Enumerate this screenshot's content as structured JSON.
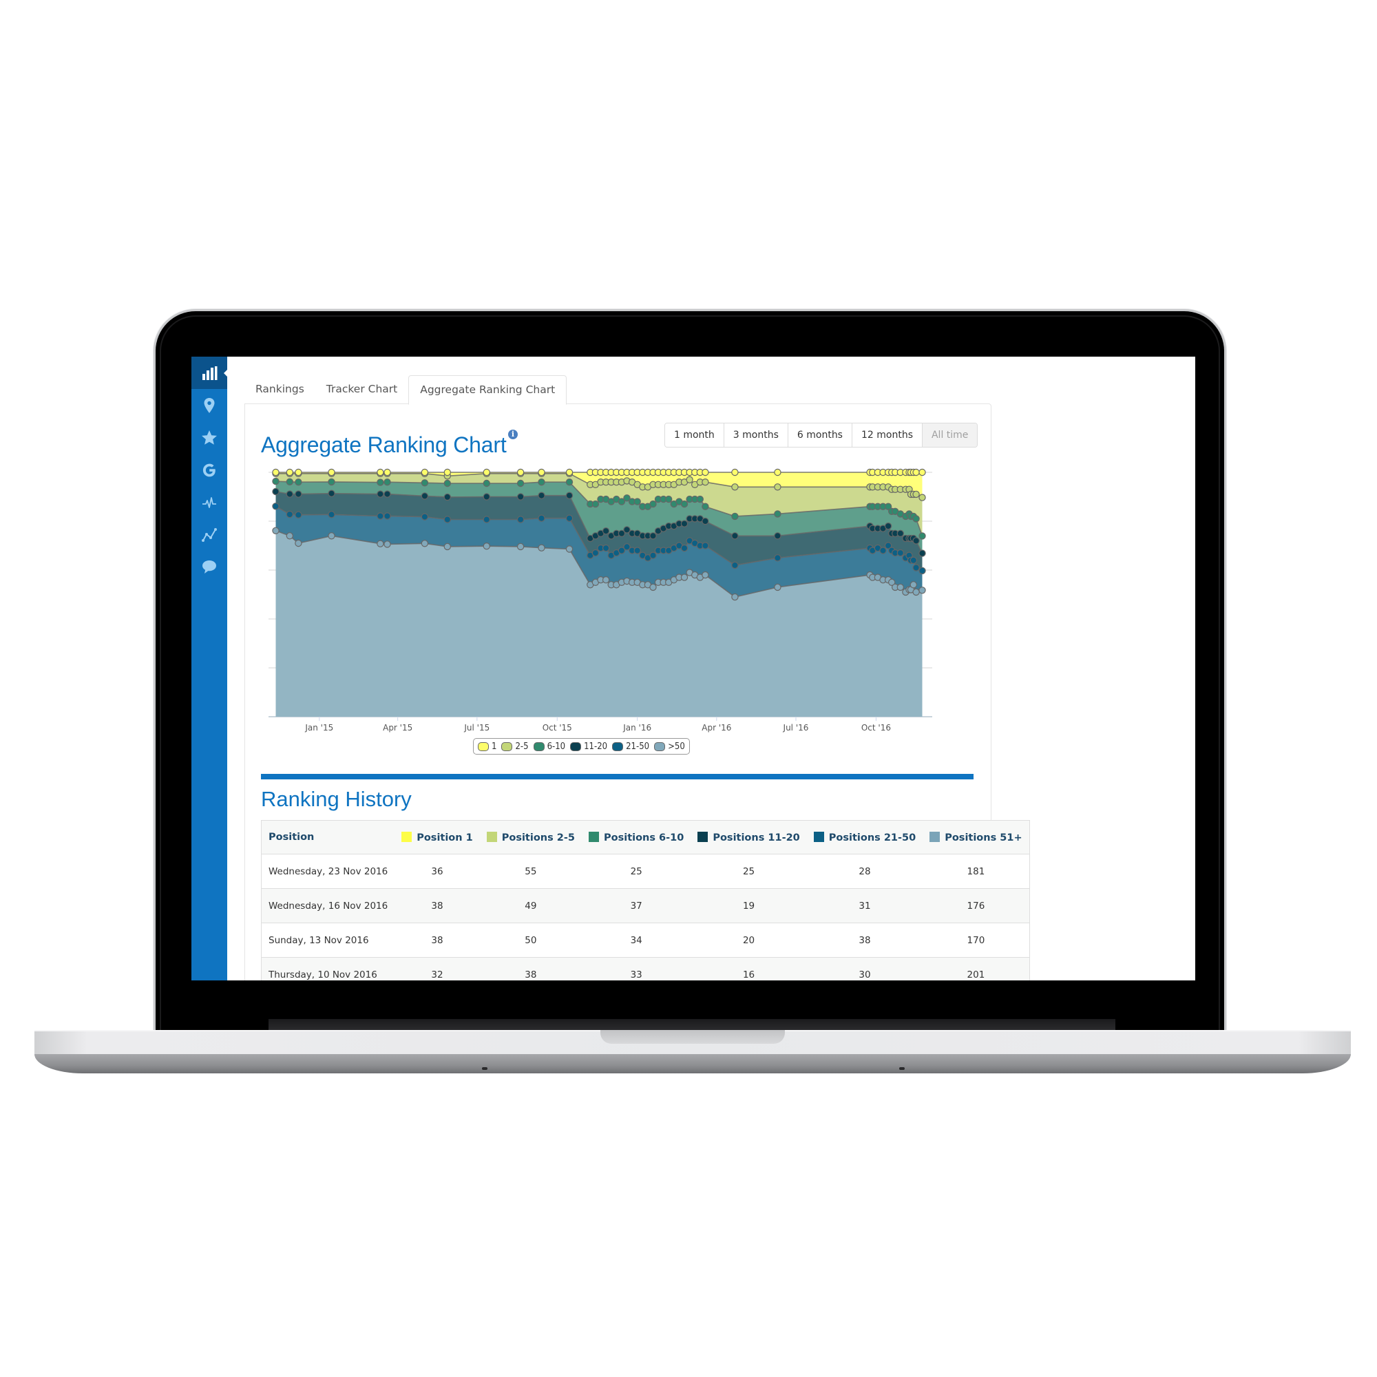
{
  "sidebar": {
    "items": [
      {
        "name": "rankings",
        "icon": "bar-chart-icon",
        "active": true
      },
      {
        "name": "locations",
        "icon": "map-pin-icon",
        "active": false
      },
      {
        "name": "reviews",
        "icon": "star-icon",
        "active": false
      },
      {
        "name": "google",
        "icon": "google-g-icon",
        "active": false
      },
      {
        "name": "activity",
        "icon": "pulse-icon",
        "active": false
      },
      {
        "name": "trends",
        "icon": "line-chart-icon",
        "active": false
      },
      {
        "name": "messages",
        "icon": "speech-bubble-icon",
        "active": false
      }
    ]
  },
  "tabs": [
    {
      "label": "Rankings",
      "active": false
    },
    {
      "label": "Tracker Chart",
      "active": false
    },
    {
      "label": "Aggregate Ranking Chart",
      "active": true
    }
  ],
  "chart_section": {
    "title": "Aggregate Ranking Chart",
    "info_icon": "info-icon",
    "ranges": [
      {
        "label": "1 month",
        "active": false
      },
      {
        "label": "3 months",
        "active": false
      },
      {
        "label": "6 months",
        "active": false
      },
      {
        "label": "12 months",
        "active": false
      },
      {
        "label": "All time",
        "active": true
      }
    ]
  },
  "chart_data": {
    "type": "area",
    "stacking": "percent",
    "title": "Aggregate Ranking Chart",
    "xlabel": "",
    "ylabel": "",
    "ylim": [
      0,
      100
    ],
    "y_gridlines": [
      0,
      20,
      40,
      60,
      80,
      100
    ],
    "grid": true,
    "legend_position": "bottom-center",
    "x_ticks": [
      "Jan '15",
      "Apr '15",
      "Jul '15",
      "Oct '15",
      "Jan '16",
      "Apr '16",
      "Jul '16",
      "Oct '16"
    ],
    "x_tick_dates": [
      "2015-01-01",
      "2015-04-01",
      "2015-07-01",
      "2015-10-01",
      "2016-01-01",
      "2016-04-01",
      "2016-07-01",
      "2016-10-01"
    ],
    "x_range": [
      "2014-11-10",
      "2016-11-25"
    ],
    "x": [
      "2014-11-12",
      "2014-11-28",
      "2014-12-08",
      "2015-01-15",
      "2015-03-12",
      "2015-03-20",
      "2015-05-02",
      "2015-05-28",
      "2015-07-12",
      "2015-08-20",
      "2015-09-13",
      "2015-10-15",
      "2015-11-08",
      "2015-11-14",
      "2015-11-20",
      "2015-11-26",
      "2015-12-02",
      "2015-12-08",
      "2015-12-14",
      "2015-12-20",
      "2015-12-26",
      "2016-01-01",
      "2016-01-07",
      "2016-01-13",
      "2016-01-19",
      "2016-01-25",
      "2016-01-31",
      "2016-02-06",
      "2016-02-12",
      "2016-02-18",
      "2016-02-24",
      "2016-03-01",
      "2016-03-07",
      "2016-03-13",
      "2016-03-19",
      "2016-04-22",
      "2016-06-10",
      "2016-09-24",
      "2016-09-27",
      "2016-10-03",
      "2016-10-09",
      "2016-10-15",
      "2016-10-19",
      "2016-10-23",
      "2016-10-29",
      "2016-11-04",
      "2016-11-08",
      "2016-11-10",
      "2016-11-13",
      "2016-11-16",
      "2016-11-23"
    ],
    "series": [
      {
        "name": "1",
        "color": "#fdfd6a",
        "values": [
          0.5,
          0.5,
          0.5,
          0.5,
          0.5,
          0.5,
          0.5,
          1.5,
          0.5,
          0.5,
          0.5,
          0.5,
          5,
          5,
          4,
          4,
          4,
          4,
          4,
          3.5,
          4,
          5,
          6,
          6,
          5,
          5,
          5,
          5,
          5,
          4,
          4,
          3,
          5,
          4,
          4,
          6,
          6,
          6,
          6,
          6,
          6,
          6,
          7,
          7,
          7,
          7,
          7,
          9,
          9,
          9,
          10.3
        ]
      },
      {
        "name": "2-5",
        "color": "#c3d678",
        "values": [
          3.2,
          3.4,
          3.5,
          3.4,
          3.6,
          3.5,
          3.8,
          3.0,
          4.0,
          4.0,
          3.5,
          3.5,
          8,
          8,
          7,
          7,
          8,
          7,
          8,
          7,
          8,
          7,
          8,
          8,
          8,
          6,
          6,
          6,
          8,
          8,
          9,
          8,
          6,
          7,
          10,
          12,
          11,
          8,
          8,
          8,
          8,
          8,
          9,
          9,
          10,
          11,
          10,
          9,
          9,
          10,
          15.7
        ]
      },
      {
        "name": "6-10",
        "color": "#318a6e",
        "values": [
          4.2,
          5.0,
          4.9,
          4.7,
          4.8,
          4.9,
          5.4,
          5.6,
          5.5,
          5.5,
          5.5,
          5.5,
          14,
          13,
          14,
          13,
          14,
          14,
          13,
          13,
          13,
          13,
          12,
          12,
          13,
          13,
          12,
          11,
          9,
          9,
          8,
          8,
          8,
          8,
          6,
          8,
          9,
          8,
          9,
          9,
          9,
          8,
          9,
          9,
          8,
          9,
          10,
          9,
          9,
          9,
          7.1
        ]
      },
      {
        "name": "11-20",
        "color": "#0b4050",
        "values": [
          6.0,
          8.3,
          8.5,
          8.6,
          9.0,
          9.0,
          8.5,
          9.2,
          9.3,
          9.3,
          9.3,
          9.3,
          7,
          7,
          6,
          7,
          8,
          8,
          7,
          7,
          7,
          7,
          8,
          9,
          8,
          8,
          9,
          10,
          9,
          9,
          10,
          9,
          10,
          11,
          10,
          12,
          9,
          9,
          9,
          8,
          9,
          8,
          7,
          8,
          8,
          8,
          7,
          9,
          9,
          11,
          7.1
        ]
      },
      {
        "name": "21-50",
        "color": "#0c6085",
        "values": [
          10.0,
          8.8,
          11.6,
          8.7,
          11.3,
          11.5,
          10.9,
          11.1,
          10.9,
          11.1,
          12.1,
          12.6,
          12,
          12,
          13,
          13,
          12,
          13,
          13,
          14,
          13,
          13,
          12,
          11,
          13,
          13,
          13,
          13,
          13,
          13,
          12,
          13,
          13,
          13,
          12,
          13,
          12,
          11,
          11,
          12,
          12,
          14,
          13,
          14,
          14,
          14,
          14,
          12,
          10,
          10,
          8.0
        ]
      },
      {
        "name": ">50",
        "color": "#81a8ba",
        "values": [
          76.1,
          74.0,
          71.0,
          73.7,
          70.8,
          70.6,
          70.9,
          69.6,
          69.8,
          69.6,
          69.1,
          68.6,
          54,
          55,
          56,
          56,
          54,
          54,
          55,
          55.5,
          55,
          55,
          54,
          54,
          53,
          55,
          55,
          55,
          56,
          57,
          57,
          59,
          58,
          57,
          58,
          49,
          53,
          58,
          57,
          57,
          56,
          56,
          55,
          53,
          53,
          51,
          52,
          52,
          54,
          51,
          51.7
        ]
      }
    ]
  },
  "legend": [
    {
      "label": "1",
      "color": "#fdfd6a"
    },
    {
      "label": "2-5",
      "color": "#c3d678"
    },
    {
      "label": "6-10",
      "color": "#318a6e"
    },
    {
      "label": "11-20",
      "color": "#0b4050"
    },
    {
      "label": "21-50",
      "color": "#0c6085"
    },
    {
      "label": ">50",
      "color": "#81a8ba"
    }
  ],
  "history": {
    "title": "Ranking History",
    "columns": [
      {
        "label": "Position",
        "color": null
      },
      {
        "label": "Position 1",
        "color": "#fdfd48"
      },
      {
        "label": "Positions 2-5",
        "color": "#c3d678"
      },
      {
        "label": "Positions 6-10",
        "color": "#318a6e"
      },
      {
        "label": "Positions 11-20",
        "color": "#0b4050"
      },
      {
        "label": "Positions 21-50",
        "color": "#0c6085"
      },
      {
        "label": "Positions 51+",
        "color": "#7ba4b8"
      }
    ],
    "rows": [
      {
        "date": "Wednesday, 23 Nov 2016",
        "values": [
          "36",
          "55",
          "25",
          "25",
          "28",
          "181"
        ]
      },
      {
        "date": "Wednesday, 16 Nov 2016",
        "values": [
          "38",
          "49",
          "37",
          "19",
          "31",
          "176"
        ]
      },
      {
        "date": "Sunday, 13 Nov 2016",
        "values": [
          "38",
          "50",
          "34",
          "20",
          "38",
          "170"
        ]
      },
      {
        "date": "Thursday, 10 Nov 2016",
        "values": [
          "32",
          "38",
          "33",
          "16",
          "30",
          "201"
        ]
      }
    ]
  }
}
